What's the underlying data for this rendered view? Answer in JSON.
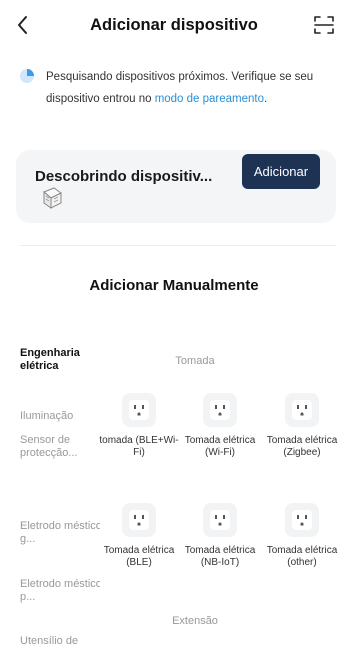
{
  "header": {
    "title": "Adicionar dispositivo"
  },
  "status": {
    "text_before": "Pesquisando dispositivos próximos. Verifique se seu dispositivo entrou no ",
    "link": "modo de pareamento",
    "text_after": "."
  },
  "discovery": {
    "title": "Descobrindo dispositiv...",
    "add_label": "Adicionar"
  },
  "manual": {
    "title": "Adicionar Manualmente"
  },
  "sidebar": {
    "items": [
      {
        "label": "Engenharia elétrica"
      },
      {
        "label": "Iluminação"
      },
      {
        "label": "Sensor de protecção..."
      },
      {
        "label": "Eletrodo méstico g..."
      },
      {
        "label": "Eletrodo méstico p..."
      },
      {
        "label": "Utensílio de"
      }
    ]
  },
  "sections": [
    {
      "label": "Tomada"
    },
    {
      "label": "Extensão"
    }
  ],
  "devices": [
    {
      "label": "tomada (BLE+Wi-Fi)"
    },
    {
      "label": "Tomada elétrica (Wi-Fi)"
    },
    {
      "label": "Tomada elétrica (Zigbee)"
    },
    {
      "label": "Tomada elétrica (BLE)"
    },
    {
      "label": "Tomada elétrica (NB-IoT)"
    },
    {
      "label": "Tomada elétrica (other)"
    }
  ]
}
